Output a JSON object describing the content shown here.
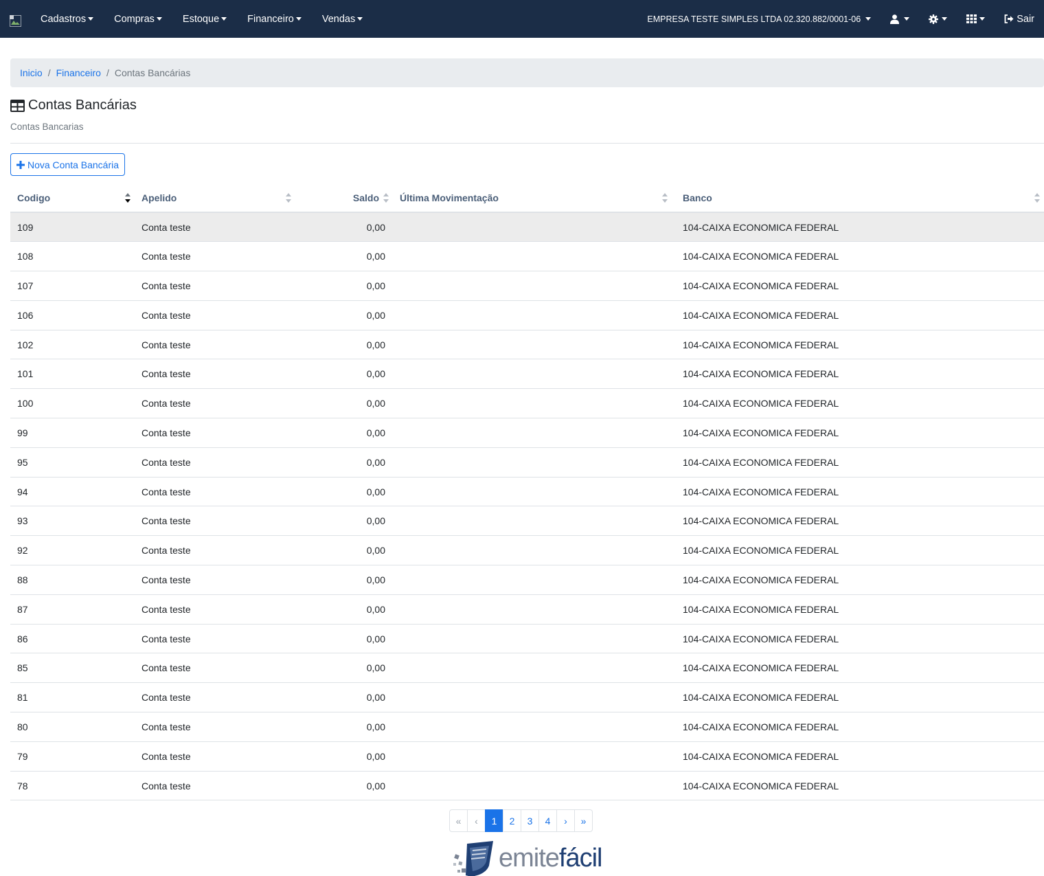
{
  "navbar": {
    "menu": [
      {
        "label": "Cadastros"
      },
      {
        "label": "Compras"
      },
      {
        "label": "Estoque"
      },
      {
        "label": "Financeiro"
      },
      {
        "label": "Vendas"
      }
    ],
    "company": "EMPRESA TESTE SIMPLES LTDA 02.320.882/0001-06",
    "user_icon": "user-icon",
    "settings_icon": "gear-icon",
    "apps_icon": "grid-icon",
    "logout_label": "Sair"
  },
  "breadcrumb": {
    "home": "Inicio",
    "section": "Financeiro",
    "current": "Contas Bancárias"
  },
  "page": {
    "title": "Contas Bancárias",
    "subtitle": "Contas Bancarias",
    "new_button": "Nova Conta Bancária"
  },
  "table": {
    "columns": [
      "Codigo",
      "Apelido",
      "Saldo",
      "Última Movimentação",
      "Banco"
    ],
    "sorted_column": "Codigo",
    "rows": [
      {
        "codigo": "109",
        "apelido": "Conta teste",
        "saldo": "0,00",
        "ultima": "",
        "banco": "104-CAIXA ECONOMICA FEDERAL"
      },
      {
        "codigo": "108",
        "apelido": "Conta teste",
        "saldo": "0,00",
        "ultima": "",
        "banco": "104-CAIXA ECONOMICA FEDERAL"
      },
      {
        "codigo": "107",
        "apelido": "Conta teste",
        "saldo": "0,00",
        "ultima": "",
        "banco": "104-CAIXA ECONOMICA FEDERAL"
      },
      {
        "codigo": "106",
        "apelido": "Conta teste",
        "saldo": "0,00",
        "ultima": "",
        "banco": "104-CAIXA ECONOMICA FEDERAL"
      },
      {
        "codigo": "102",
        "apelido": "Conta teste",
        "saldo": "0,00",
        "ultima": "",
        "banco": "104-CAIXA ECONOMICA FEDERAL"
      },
      {
        "codigo": "101",
        "apelido": "Conta teste",
        "saldo": "0,00",
        "ultima": "",
        "banco": "104-CAIXA ECONOMICA FEDERAL"
      },
      {
        "codigo": "100",
        "apelido": "Conta teste",
        "saldo": "0,00",
        "ultima": "",
        "banco": "104-CAIXA ECONOMICA FEDERAL"
      },
      {
        "codigo": "99",
        "apelido": "Conta teste",
        "saldo": "0,00",
        "ultima": "",
        "banco": "104-CAIXA ECONOMICA FEDERAL"
      },
      {
        "codigo": "95",
        "apelido": "Conta teste",
        "saldo": "0,00",
        "ultima": "",
        "banco": "104-CAIXA ECONOMICA FEDERAL"
      },
      {
        "codigo": "94",
        "apelido": "Conta teste",
        "saldo": "0,00",
        "ultima": "",
        "banco": "104-CAIXA ECONOMICA FEDERAL"
      },
      {
        "codigo": "93",
        "apelido": "Conta teste",
        "saldo": "0,00",
        "ultima": "",
        "banco": "104-CAIXA ECONOMICA FEDERAL"
      },
      {
        "codigo": "92",
        "apelido": "Conta teste",
        "saldo": "0,00",
        "ultima": "",
        "banco": "104-CAIXA ECONOMICA FEDERAL"
      },
      {
        "codigo": "88",
        "apelido": "Conta teste",
        "saldo": "0,00",
        "ultima": "",
        "banco": "104-CAIXA ECONOMICA FEDERAL"
      },
      {
        "codigo": "87",
        "apelido": "Conta teste",
        "saldo": "0,00",
        "ultima": "",
        "banco": "104-CAIXA ECONOMICA FEDERAL"
      },
      {
        "codigo": "86",
        "apelido": "Conta teste",
        "saldo": "0,00",
        "ultima": "",
        "banco": "104-CAIXA ECONOMICA FEDERAL"
      },
      {
        "codigo": "85",
        "apelido": "Conta teste",
        "saldo": "0,00",
        "ultima": "",
        "banco": "104-CAIXA ECONOMICA FEDERAL"
      },
      {
        "codigo": "81",
        "apelido": "Conta teste",
        "saldo": "0,00",
        "ultima": "",
        "banco": "104-CAIXA ECONOMICA FEDERAL"
      },
      {
        "codigo": "80",
        "apelido": "Conta teste",
        "saldo": "0,00",
        "ultima": "",
        "banco": "104-CAIXA ECONOMICA FEDERAL"
      },
      {
        "codigo": "79",
        "apelido": "Conta teste",
        "saldo": "0,00",
        "ultima": "",
        "banco": "104-CAIXA ECONOMICA FEDERAL"
      },
      {
        "codigo": "78",
        "apelido": "Conta teste",
        "saldo": "0,00",
        "ultima": "",
        "banco": "104-CAIXA ECONOMICA FEDERAL"
      }
    ]
  },
  "pagination": {
    "first": "«",
    "prev": "‹",
    "pages": [
      "1",
      "2",
      "3",
      "4"
    ],
    "active_page": "1",
    "next": "›",
    "last": "»"
  },
  "footer": {
    "logo_part1": "emite",
    "logo_part2": "fácil"
  },
  "colors": {
    "navbar": "#1b2d47",
    "accent": "#1a73e8",
    "header_text": "#4a5e78",
    "logo_dark": "#1f3f73",
    "logo_gray": "#7b8494"
  }
}
